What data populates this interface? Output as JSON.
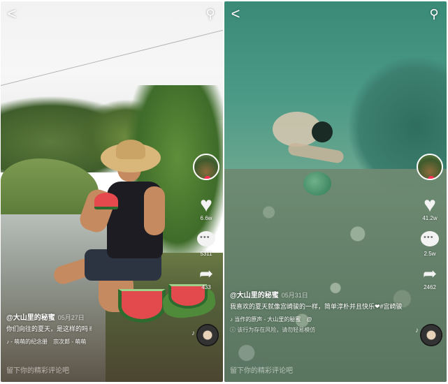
{
  "left": {
    "nav": {
      "back": "<",
      "search": "⚲"
    },
    "author": "@大山里的秘蜜",
    "date": "05月27日",
    "caption": "你们向往的夏天，是这样的吗✌",
    "music": "♪ - 萌萌的纪念册　宗次郎 - 萌萌",
    "counts": {
      "likes": "6.6w",
      "comments": "5311",
      "shares": "433"
    },
    "comment_placeholder": "留下你的精彩评论吧"
  },
  "right": {
    "nav": {
      "back": "<",
      "search": "⚲"
    },
    "author": "@大山里的秘蜜",
    "date": "05月31日",
    "caption": "我喜欢的夏天就像宫崎骏的一样，简单淳朴并且快乐❤#宫崎骏",
    "music": "♪ 当作的原声 - 大山里的秘蜜　@",
    "extra": "ⓘ 该行为存在风险，请勿轻易模仿",
    "counts": {
      "likes": "41.2w",
      "comments": "2.5w",
      "shares": "2462"
    },
    "comment_placeholder": "留下你的精彩评论吧"
  },
  "icons": {
    "back": "chevron-left-icon",
    "search": "search-icon",
    "like": "heart-icon",
    "comment": "comment-bubble-icon",
    "share": "share-arrow-icon",
    "music": "music-note-icon",
    "disc": "music-disc-icon"
  },
  "colors": {
    "overlay_text": "#ffffff",
    "follow_dot": "#ff2d55"
  }
}
